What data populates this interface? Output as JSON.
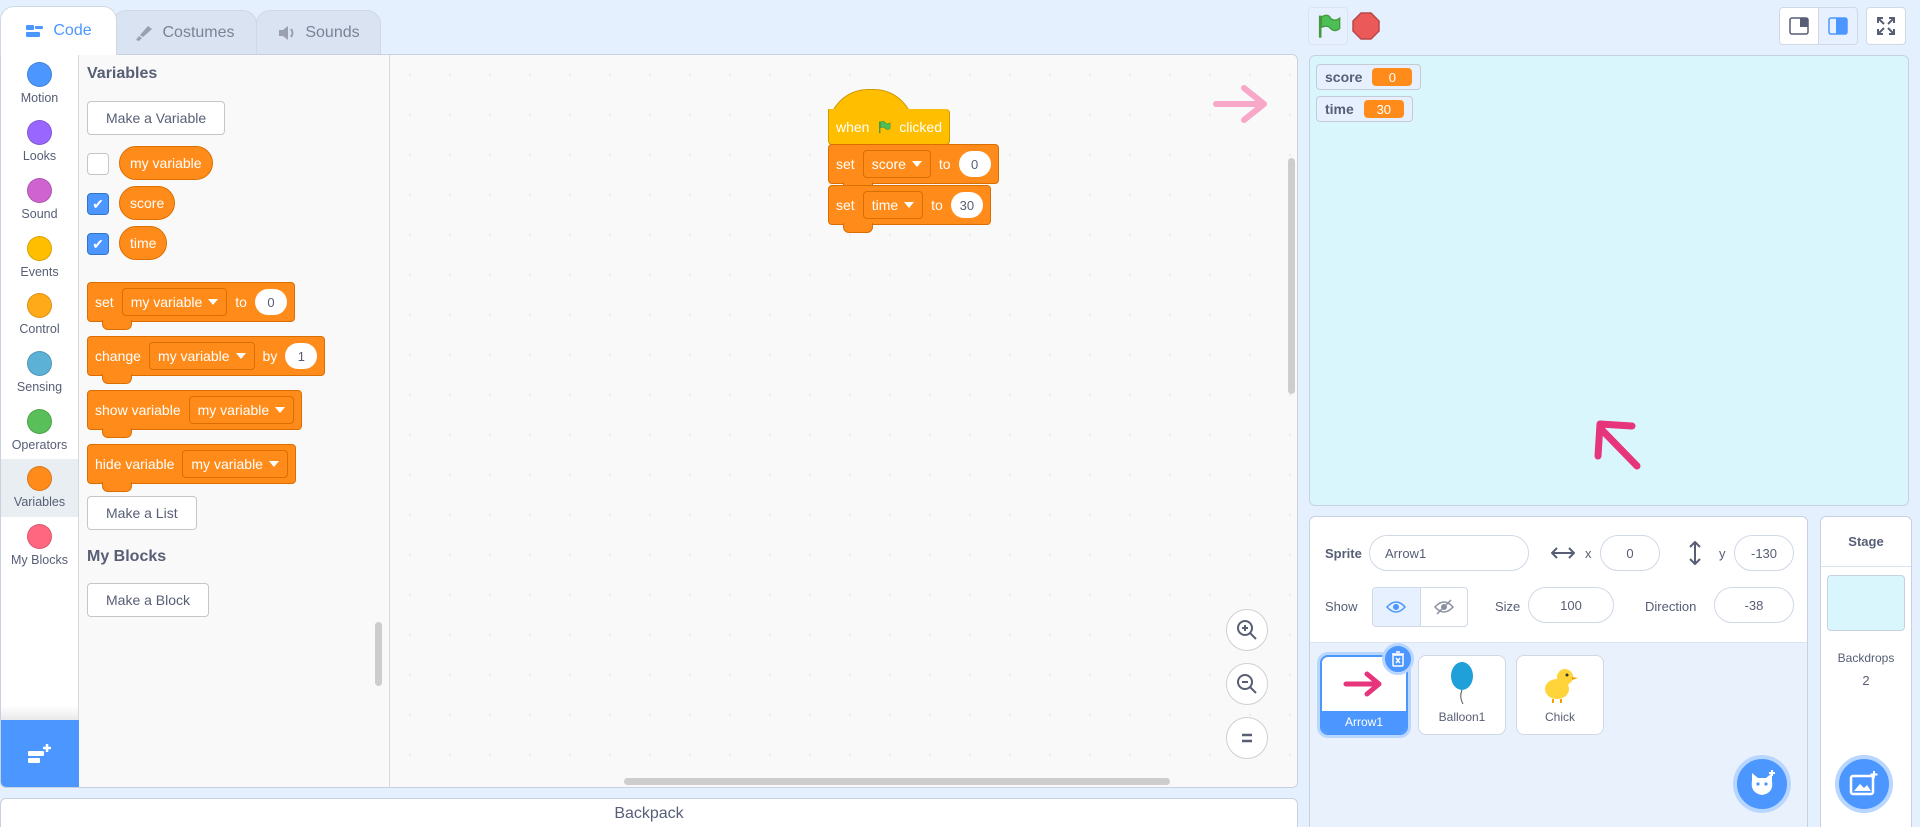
{
  "tabs": [
    {
      "label": "Code",
      "icon": "code-icon"
    },
    {
      "label": "Costumes",
      "icon": "brush-icon"
    },
    {
      "label": "Sounds",
      "icon": "speaker-icon"
    }
  ],
  "categories": [
    {
      "label": "Motion",
      "color": "#4c97ff"
    },
    {
      "label": "Looks",
      "color": "#9966ff"
    },
    {
      "label": "Sound",
      "color": "#cf63cf"
    },
    {
      "label": "Events",
      "color": "#ffbf00"
    },
    {
      "label": "Control",
      "color": "#ffab19"
    },
    {
      "label": "Sensing",
      "color": "#5cb1d6"
    },
    {
      "label": "Operators",
      "color": "#59c059"
    },
    {
      "label": "Variables",
      "color": "#ff8c1a"
    },
    {
      "label": "My Blocks",
      "color": "#ff6680"
    }
  ],
  "palette": {
    "variables_heading": "Variables",
    "make_variable": "Make a Variable",
    "variables": [
      {
        "name": "my variable",
        "checked": false
      },
      {
        "name": "score",
        "checked": true
      },
      {
        "name": "time",
        "checked": true
      }
    ],
    "set_block": {
      "verb": "set",
      "var": "my variable",
      "to": "to",
      "value": "0"
    },
    "change_block": {
      "verb": "change",
      "var": "my variable",
      "by": "by",
      "value": "1"
    },
    "show_block": {
      "verb": "show variable",
      "var": "my variable"
    },
    "hide_block": {
      "verb": "hide variable",
      "var": "my variable"
    },
    "make_list": "Make a List",
    "myblocks_heading": "My Blocks",
    "make_block": "Make a Block"
  },
  "script": {
    "hat": {
      "when": "when",
      "clicked": "clicked"
    },
    "set1": {
      "verb": "set",
      "var": "score",
      "to": "to",
      "value": "0"
    },
    "set2": {
      "verb": "set",
      "var": "time",
      "to": "to",
      "value": "30"
    }
  },
  "backpack": "Backpack",
  "monitors": [
    {
      "name": "score",
      "value": "0"
    },
    {
      "name": "time",
      "value": "30"
    }
  ],
  "sprite_info": {
    "sprite_label": "Sprite",
    "sprite_name": "Arrow1",
    "x_label": "x",
    "x_value": "0",
    "y_label": "y",
    "y_value": "-130",
    "show_label": "Show",
    "size_label": "Size",
    "size_value": "100",
    "direction_label": "Direction",
    "direction_value": "-38"
  },
  "sprites": [
    {
      "name": "Arrow1",
      "selected": true
    },
    {
      "name": "Balloon1",
      "selected": false
    },
    {
      "name": "Chick",
      "selected": false
    }
  ],
  "stage_pane": {
    "title": "Stage",
    "backdrops_label": "Backdrops",
    "backdrops_count": "2"
  }
}
